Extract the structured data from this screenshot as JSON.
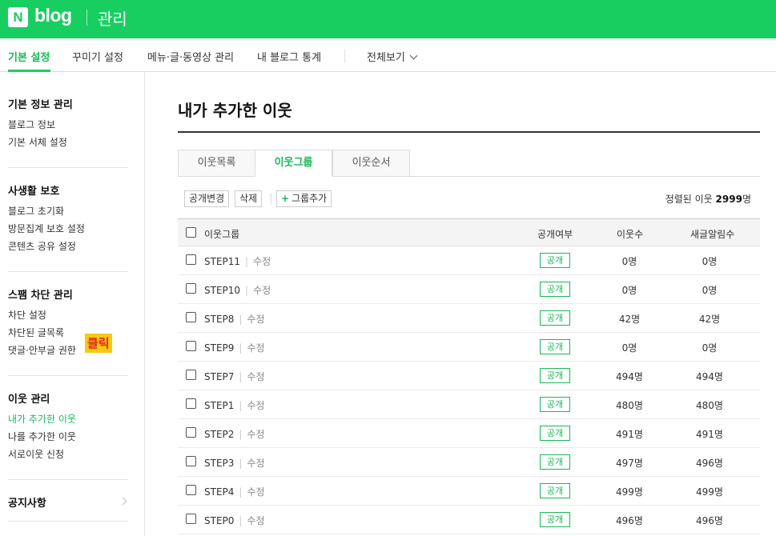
{
  "header": {
    "logo_mark": "N",
    "logo_text": "blog",
    "title": "관리"
  },
  "nav": {
    "items": [
      "기본 설정",
      "꾸미기 설정",
      "메뉴·글·동영상 관리",
      "내 블로그 통계",
      "전체보기"
    ]
  },
  "sidebar": {
    "sections": [
      {
        "title": "기본 정보 관리",
        "items": [
          "블로그 정보",
          "기본 서체 설정"
        ]
      },
      {
        "title": "사생활 보호",
        "items": [
          "블로그 초기화",
          "방문집계 보호 설정",
          "콘텐츠 공유 설정"
        ]
      },
      {
        "title": "스팸 차단 관리",
        "items": [
          "차단 설정",
          "차단된 글목록",
          "댓글·안부글 권한"
        ]
      },
      {
        "title": "이웃 관리",
        "items": [
          "내가 추가한 이웃",
          "나를 추가한 이웃",
          "서로이웃 신청"
        ]
      },
      {
        "title": "공지사항",
        "items": []
      }
    ],
    "annotation": "클릭"
  },
  "main": {
    "title": "내가 추가한 이웃",
    "tabs": [
      "이웃목록",
      "이웃그룹",
      "이웃순서"
    ],
    "active_tab": "이웃그룹",
    "buttons": {
      "visibility": "공개변경",
      "delete": "삭제",
      "add_group": "그룹추가"
    },
    "sort_label": "정렬된 이웃",
    "sort_count": "2999",
    "sort_unit": "명",
    "columns": [
      "이웃그룹",
      "공개여부",
      "이웃수",
      "새글알림수"
    ],
    "edit_label": "수정",
    "rows": [
      {
        "name": "STEP11",
        "visibility": "공개",
        "neighbors": "0명",
        "alerts": "0명"
      },
      {
        "name": "STEP10",
        "visibility": "공개",
        "neighbors": "0명",
        "alerts": "0명"
      },
      {
        "name": "STEP8",
        "visibility": "공개",
        "neighbors": "42명",
        "alerts": "42명"
      },
      {
        "name": "STEP9",
        "visibility": "공개",
        "neighbors": "0명",
        "alerts": "0명"
      },
      {
        "name": "STEP7",
        "visibility": "공개",
        "neighbors": "494명",
        "alerts": "494명"
      },
      {
        "name": "STEP1",
        "visibility": "공개",
        "neighbors": "480명",
        "alerts": "480명"
      },
      {
        "name": "STEP2",
        "visibility": "공개",
        "neighbors": "491명",
        "alerts": "491명"
      },
      {
        "name": "STEP3",
        "visibility": "공개",
        "neighbors": "497명",
        "alerts": "496명"
      },
      {
        "name": "STEP4",
        "visibility": "공개",
        "neighbors": "499명",
        "alerts": "499명"
      },
      {
        "name": "STEP0",
        "visibility": "공개",
        "neighbors": "496명",
        "alerts": "496명"
      }
    ]
  },
  "colors": {
    "brand": "#19ce60",
    "accent_text": "#19b857",
    "annotation_bg": "#f7c913",
    "annotation_text": "#e0241b"
  }
}
